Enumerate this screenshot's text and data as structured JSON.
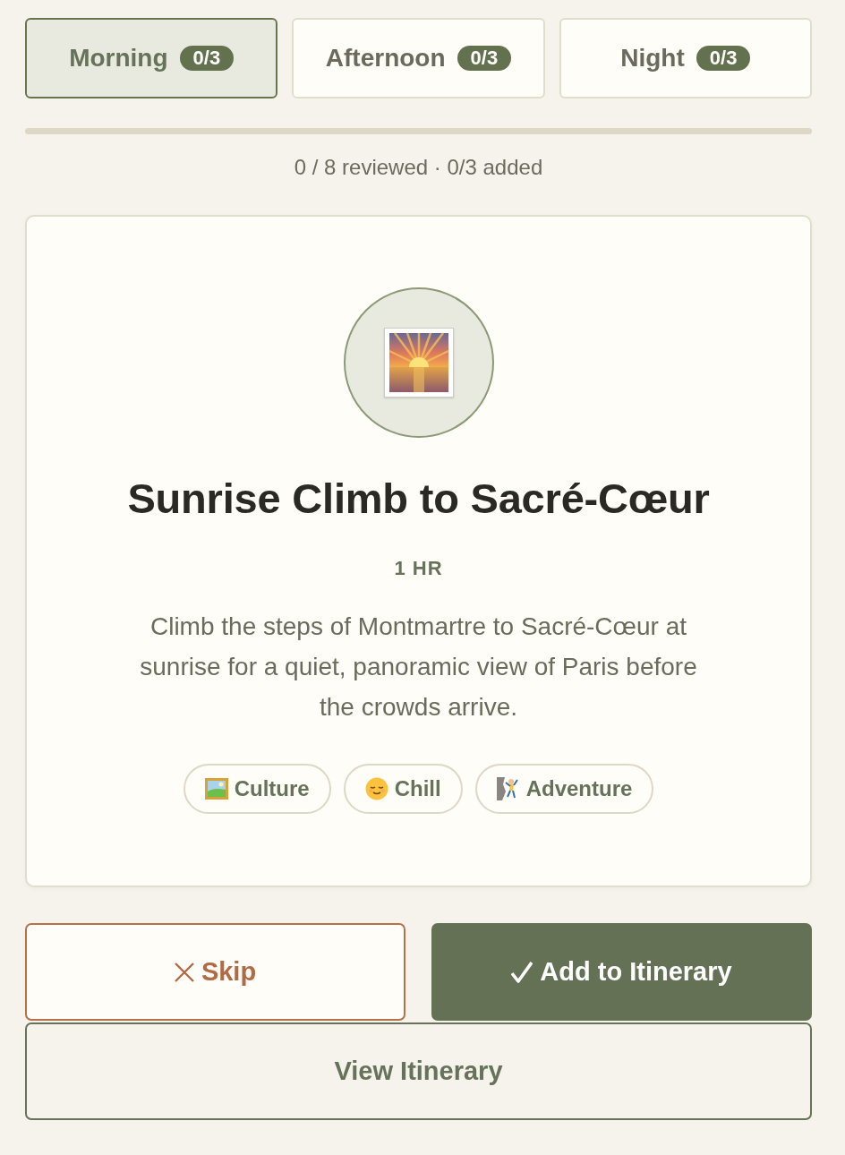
{
  "tabs": [
    {
      "label": "Morning",
      "count": "0/3",
      "selected": true
    },
    {
      "label": "Afternoon",
      "count": "0/3",
      "selected": false
    },
    {
      "label": "Night",
      "count": "0/3",
      "selected": false
    }
  ],
  "progress": {
    "level": 0,
    "status": "0 / 8 reviewed · 0/3 added"
  },
  "card": {
    "title": "Sunrise Climb to Sacré-Cœur",
    "duration": "1 HR",
    "description": "Climb the steps of Montmartre to Sacré-Cœur at sunrise for a quiet, panoramic view of Paris before the crowds arrive.",
    "tags": [
      {
        "kind": "culture",
        "label": "Culture"
      },
      {
        "kind": "chill",
        "label": "Chill"
      },
      {
        "kind": "adventure",
        "label": "Adventure"
      }
    ]
  },
  "actions": [
    {
      "kind": "skip",
      "label": "Skip"
    },
    {
      "kind": "add",
      "label": "Add to Itinerary"
    }
  ],
  "view_button": {
    "label": "View Itinerary"
  }
}
